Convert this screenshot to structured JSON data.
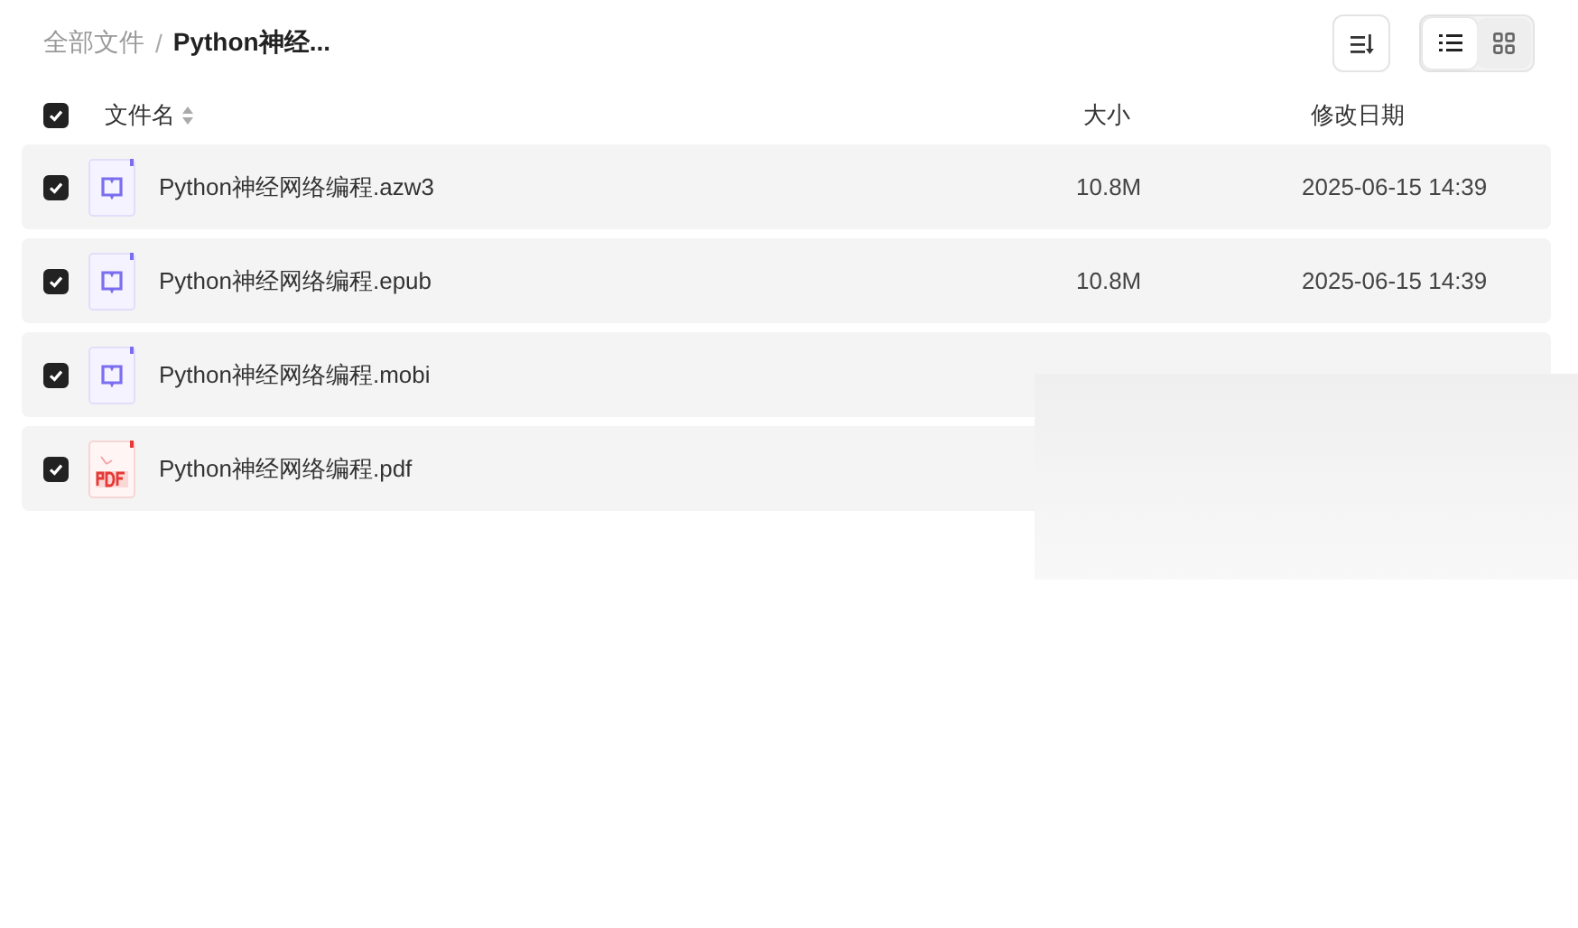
{
  "breadcrumb": [
    {
      "label": "全部文件",
      "current": false
    },
    {
      "label": "Python神经...",
      "current": true
    }
  ],
  "separator": "/",
  "view_toggle": [
    {
      "kind": "list",
      "selected": true
    },
    {
      "kind": "grid",
      "selected": false
    }
  ],
  "header": {
    "checked": true,
    "name": "文件名",
    "size": "大小",
    "modified": "修改日期"
  },
  "files": [
    {
      "checked": true,
      "kind": "ebook",
      "name": "Python神经网络编程.azw3",
      "size": "10.8M",
      "modified": "2025-06-15 14:39"
    },
    {
      "checked": true,
      "kind": "ebook",
      "name": "Python神经网络编程.epub",
      "size": "10.8M",
      "modified": "2025-06-15 14:39"
    },
    {
      "checked": true,
      "kind": "ebook",
      "name": "Python神经网络编程.mobi"
    },
    {
      "checked": true,
      "kind": "pdf",
      "name": "Python神经网络编程.pdf"
    }
  ],
  "overlay": {
    "kind": "blank-panel"
  }
}
